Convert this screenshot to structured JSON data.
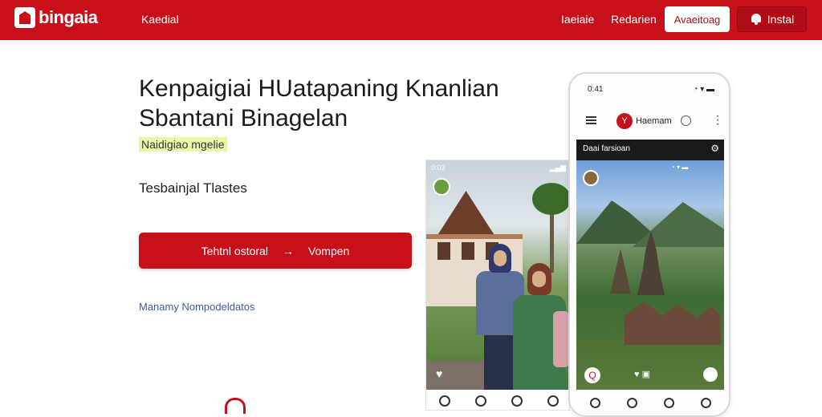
{
  "brand": {
    "name": "bingaia",
    "accent": "#c8101b"
  },
  "nav": {
    "link_1": "Kaedial",
    "link_2": "Iaeiaie",
    "link_3": "Redarien",
    "outline_button": "Avaeitoag",
    "install_button": "Instal"
  },
  "hero": {
    "headline_line1": "Kenpaigiai HUatapaning Knanlian",
    "headline_line2": "Sbantani Binagelan",
    "tagline": "Naidigiao mgelie",
    "subhead": "Tesbainjal Tlastes",
    "cta_left": "Tehtnl ostoral",
    "cta_arrow": "→",
    "cta_right": "Vompen",
    "link": "Manamy Nompodeldatos"
  },
  "photo_card": {
    "status_time": "0:03",
    "icons": [
      "heart-icon",
      "comment-icon",
      "share-icon",
      "like-icon"
    ]
  },
  "phone": {
    "status_time": "0:41",
    "app_title": "Haemam",
    "logo_letter": "Y",
    "menu_label": "Daai farsioan",
    "more_glyph": "⋮",
    "gear_glyph": "⚙",
    "photo_logo": "Q"
  }
}
